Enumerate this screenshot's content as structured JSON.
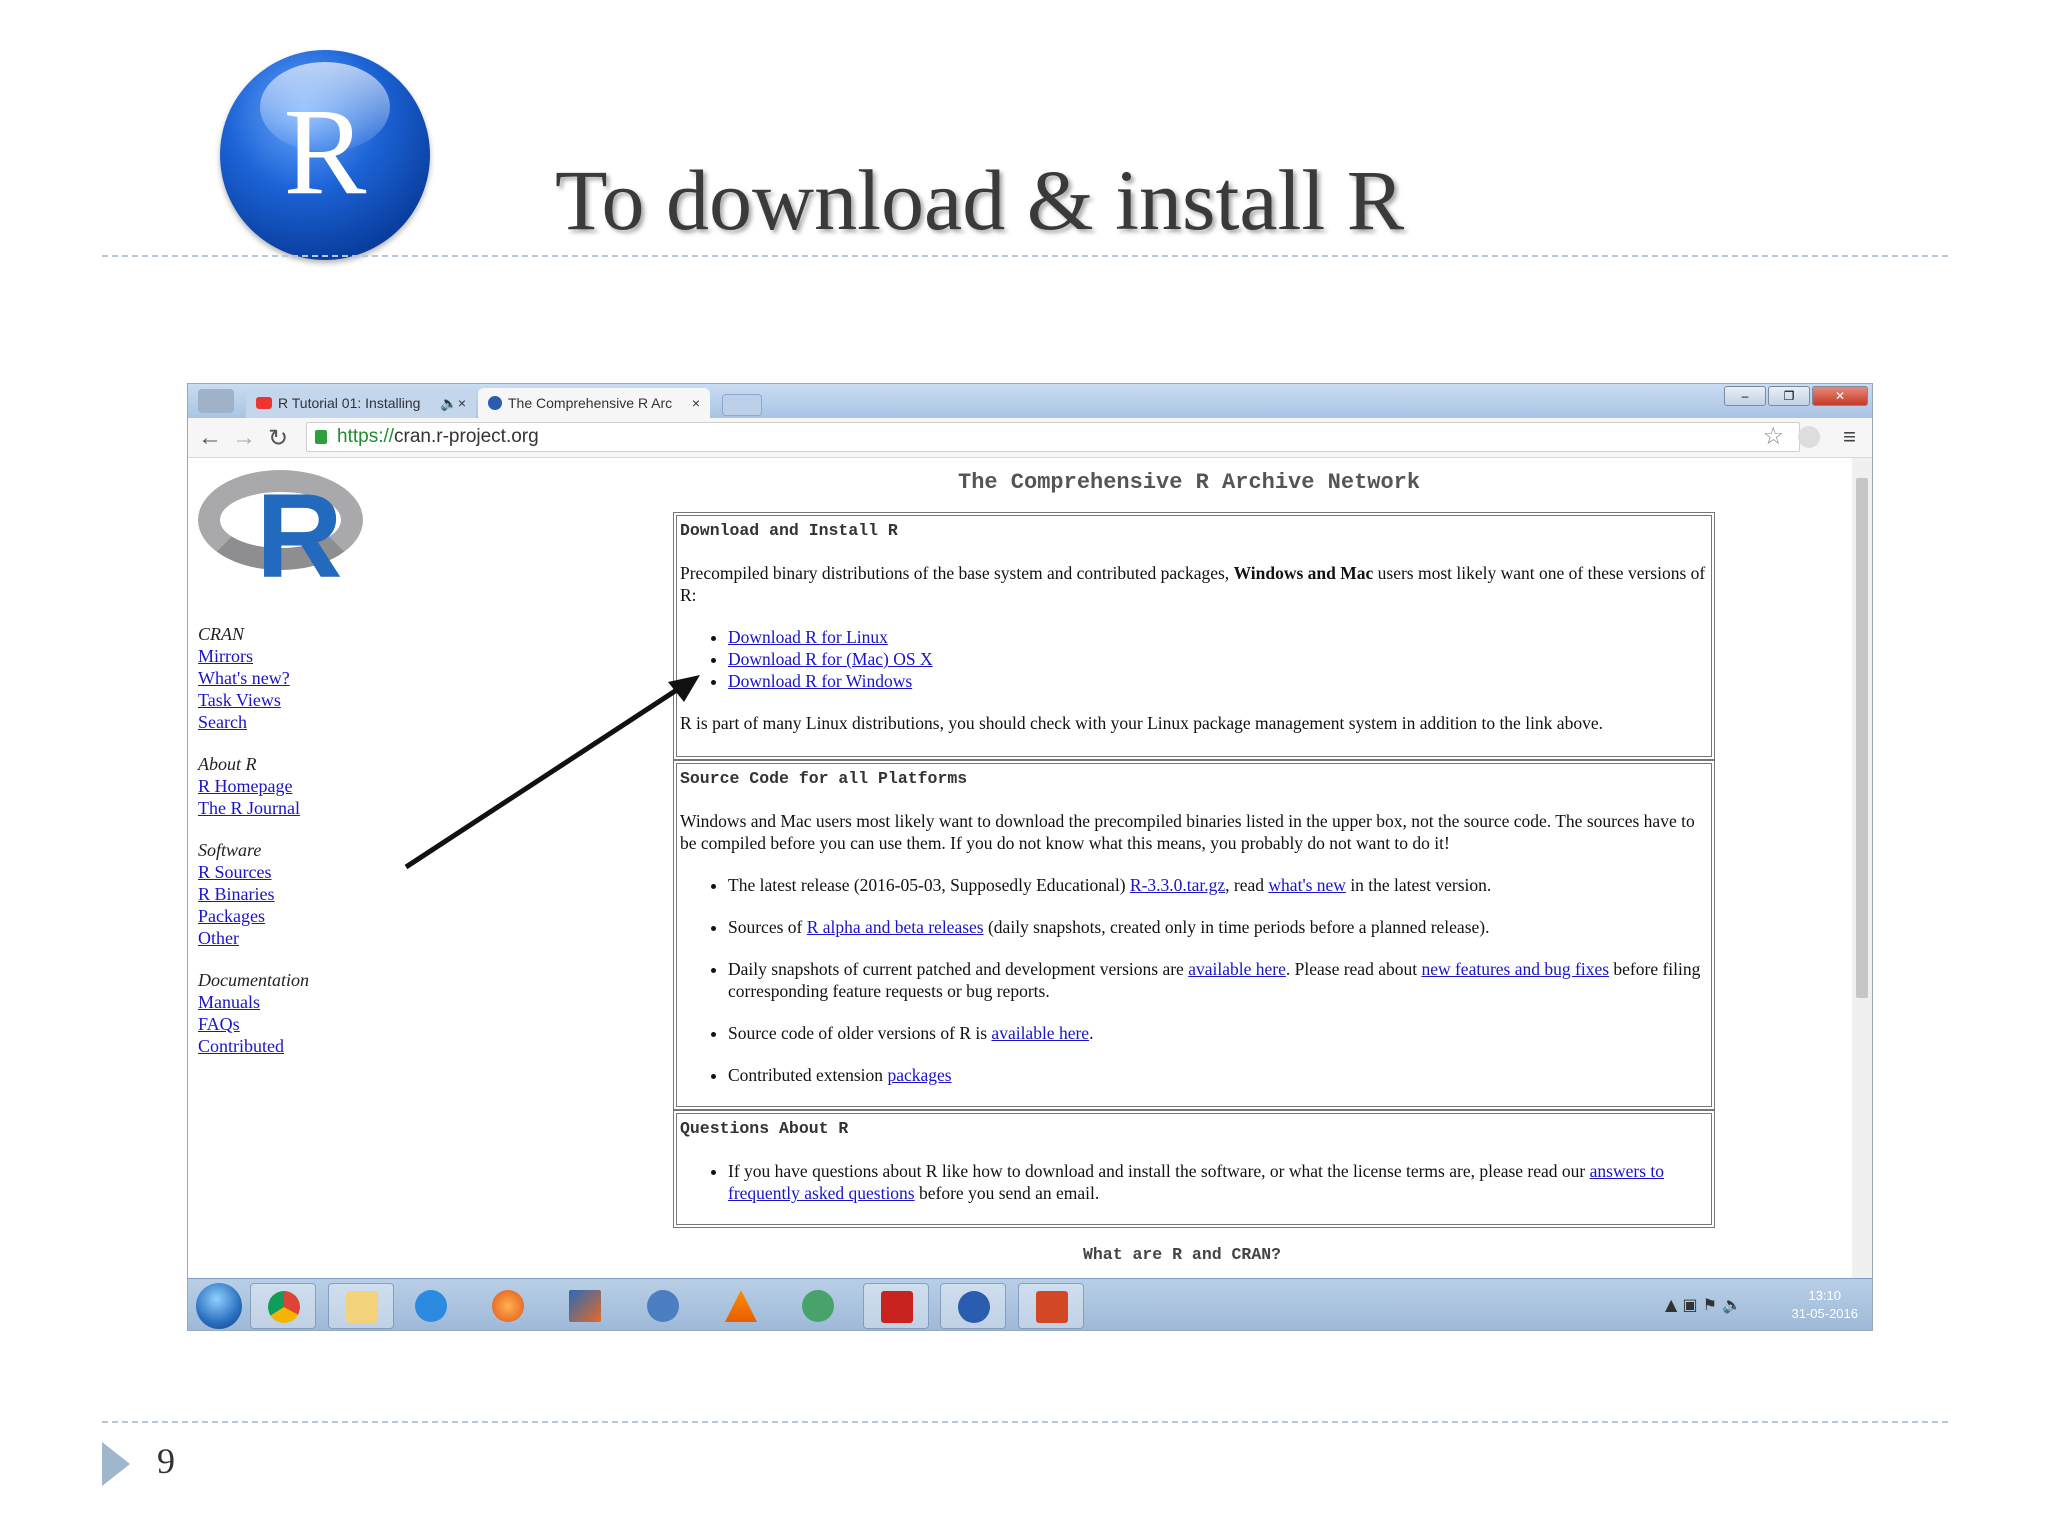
{
  "slide": {
    "title": "To download & install R",
    "page_number": "9",
    "logo_letter": "R"
  },
  "browser": {
    "tabs": [
      {
        "label": "R Tutorial 01: Installing",
        "icon": "youtube-icon",
        "active": false
      },
      {
        "label": "The Comprehensive R Arc",
        "icon": "r-favicon-icon",
        "active": true
      }
    ],
    "url_scheme": "https://",
    "url_host": "cran.r-project.org",
    "page_title": "The Comprehensive R Archive Network"
  },
  "sidebar": {
    "logo_letter": "R",
    "groups": [
      {
        "heading": "CRAN",
        "links": [
          "Mirrors",
          "What's new?",
          "Task Views",
          "Search"
        ]
      },
      {
        "heading": "About R",
        "links": [
          "R Homepage",
          "The R Journal"
        ]
      },
      {
        "heading": "Software",
        "links": [
          "R Sources",
          "R Binaries",
          "Packages",
          "Other"
        ]
      },
      {
        "heading": "Documentation",
        "links": [
          "Manuals",
          "FAQs",
          "Contributed"
        ]
      }
    ]
  },
  "download_box": {
    "heading": "Download and Install R",
    "intro_before": "Precompiled binary distributions of the base system and contributed packages, ",
    "intro_bold": "Windows and Mac",
    "intro_after": " users most likely want one of these versions of R:",
    "links": [
      "Download R for Linux",
      "Download R for (Mac) OS X",
      "Download R for Windows"
    ],
    "note": "R is part of many Linux distributions, you should check with your Linux package management system in addition to the link above."
  },
  "source_box": {
    "heading": "Source Code for all Platforms",
    "intro": "Windows and Mac users most likely want to download the precompiled binaries listed in the upper box, not the source code. The sources have to be compiled before you can use them. If you do not know what this means, you probably do not want to do it!",
    "item1_a": "The latest release (2016-05-03, Supposedly Educational) ",
    "item1_link1": "R-3.3.0.tar.gz",
    "item1_b": ", read ",
    "item1_link2": "what's new",
    "item1_c": " in the latest version.",
    "item2_a": "Sources of ",
    "item2_link": "R alpha and beta releases",
    "item2_b": " (daily snapshots, created only in time periods before a planned release).",
    "item3_a": "Daily snapshots of current patched and development versions are ",
    "item3_link1": "available here",
    "item3_b": ". Please read about ",
    "item3_link2": "new features and bug fixes",
    "item3_c": " before filing corresponding feature requests or bug reports.",
    "item4_a": "Source code of older versions of R is ",
    "item4_link": "available here",
    "item4_b": ".",
    "item5_a": "Contributed extension ",
    "item5_link": "packages"
  },
  "questions_box": {
    "heading": "Questions About R",
    "text_a": "If you have questions about R like how to download and install the software, or what the license terms are, please read our ",
    "link": "answers to frequently asked questions",
    "text_b": " before you send an email."
  },
  "what_are": "What are R and CRAN?",
  "taskbar": {
    "icons": [
      "chrome-icon",
      "file-explorer-icon",
      "internet-explorer-icon",
      "firefox-icon",
      "matlab-icon",
      "calculator-icon",
      "vlc-icon",
      "user-icon",
      "acrobat-icon",
      "r-icon",
      "powerpoint-icon"
    ],
    "time": "13:10",
    "date": "31-05-2016",
    "tray_up": "▲"
  },
  "colors": {
    "link": "#1a13c9",
    "r_blue": "#2369bd",
    "arrow": "#111111"
  }
}
